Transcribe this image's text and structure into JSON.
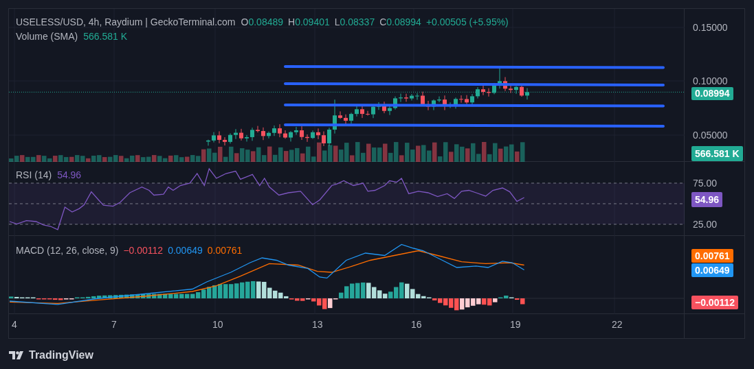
{
  "legend": {
    "symbol": "USELESS/USD, 4h, Raydium | GeckoTerminal.com",
    "ohlc": [
      {
        "label": "O",
        "value": "0.08489"
      },
      {
        "label": "H",
        "value": "0.09401"
      },
      {
        "label": "L",
        "value": "0.08337"
      },
      {
        "label": "C",
        "value": "0.08994"
      }
    ],
    "change": "+0.00505 (+5.95%)"
  },
  "volume_legend": {
    "label": "Volume (SMA)",
    "value": "566.581 K"
  },
  "price_axis": {
    "ticks": [
      "0.15000",
      "0.10000",
      "0.05000"
    ],
    "last_price": "0.08994",
    "volume": "566.581 K"
  },
  "rsi": {
    "label": "RSI (14)",
    "value": "54.96",
    "ticks": [
      "75.00",
      "25.00"
    ],
    "badge": "54.96"
  },
  "macd": {
    "label": "MACD (12, 26, close, 9)",
    "values": [
      {
        "text": "−0.00112",
        "color": "#f7525f"
      },
      {
        "text": "0.00649",
        "color": "#2196f3"
      },
      {
        "text": "0.00761",
        "color": "#ff6d00"
      }
    ],
    "badges": [
      {
        "text": "0.00761",
        "color": "#ff6d00"
      },
      {
        "text": "0.00649",
        "color": "#2196f3"
      },
      {
        "text": "−0.00112",
        "color": "#f7525f"
      }
    ]
  },
  "time_axis": [
    "4",
    "7",
    "10",
    "13",
    "16",
    "19",
    "22"
  ],
  "brand": "TradingView"
}
